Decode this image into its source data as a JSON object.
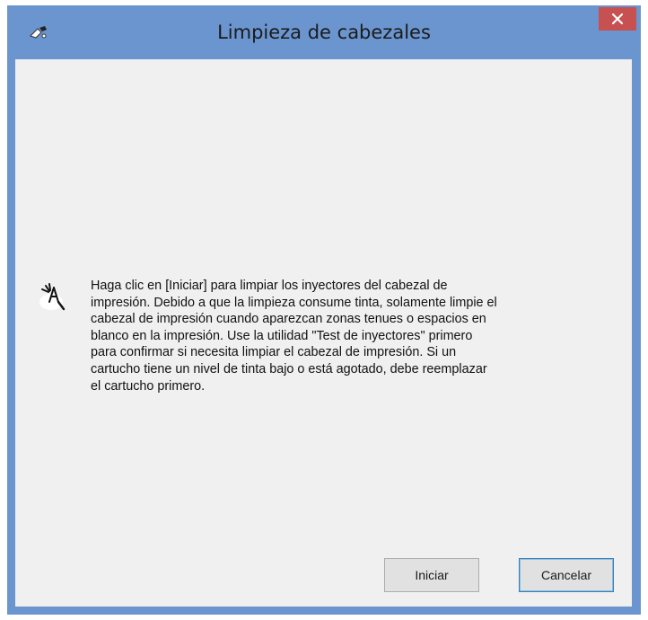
{
  "window": {
    "title": "Limpieza de cabezales",
    "close_icon": "close-icon",
    "app_icon": "printer-head-icon"
  },
  "dialog": {
    "icon": "nozzle-cleaning-icon",
    "message": "Haga clic en [Iniciar] para limpiar los inyectores del cabezal de\nimpresión. Debido a que la limpieza consume tinta, solamente limpie el\ncabezal de impresión cuando aparezcan zonas tenues o espacios en\nblanco en la impresión. Use la utilidad \"Test de inyectores\" primero\npara confirmar si necesita limpiar el cabezal de impresión. Si un\ncartucho tiene un nivel de tinta bajo o está agotado, debe reemplazar\nel cartucho primero."
  },
  "buttons": {
    "start_label": "Iniciar",
    "cancel_label": "Cancelar"
  },
  "colors": {
    "frame": "#6b95cf",
    "close": "#c75050",
    "client": "#f0f0f0"
  }
}
